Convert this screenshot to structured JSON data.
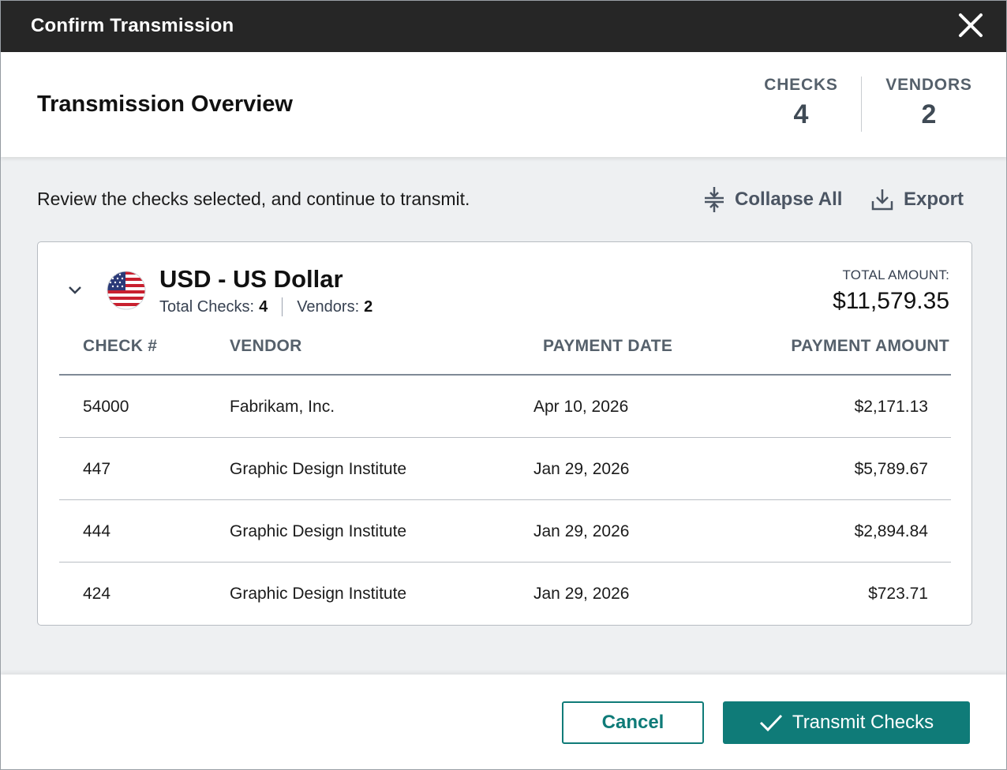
{
  "dialog": {
    "title": "Confirm Transmission"
  },
  "overview": {
    "title": "Transmission Overview",
    "checks_label": "CHECKS",
    "checks_value": "4",
    "vendors_label": "VENDORS",
    "vendors_value": "2"
  },
  "toolbar": {
    "review_text": "Review the checks selected, and continue to transmit.",
    "collapse_label": "Collapse All",
    "export_label": "Export"
  },
  "currency_group": {
    "name": "USD - US Dollar",
    "total_checks_label": "Total Checks:",
    "total_checks_value": "4",
    "vendors_label": "Vendors:",
    "vendors_value": "2",
    "total_amount_label": "TOTAL AMOUNT:",
    "total_amount_value": "$11,579.35",
    "flag_icon": "us-flag-icon"
  },
  "table": {
    "columns": [
      "CHECK #",
      "VENDOR",
      "PAYMENT DATE",
      "PAYMENT AMOUNT"
    ],
    "rows": [
      {
        "check": "54000",
        "vendor": "Fabrikam, Inc.",
        "date": "Apr 10, 2026",
        "amount": "$2,171.13"
      },
      {
        "check": "447",
        "vendor": "Graphic Design Institute",
        "date": "Jan 29, 2026",
        "amount": "$5,789.67"
      },
      {
        "check": "444",
        "vendor": "Graphic Design Institute",
        "date": "Jan 29, 2026",
        "amount": "$2,894.84"
      },
      {
        "check": "424",
        "vendor": "Graphic Design Institute",
        "date": "Jan 29, 2026",
        "amount": "$723.71"
      }
    ]
  },
  "footer": {
    "cancel_label": "Cancel",
    "transmit_label": "Transmit Checks"
  },
  "colors": {
    "accent": "#0f7b78",
    "titlebar": "#262626",
    "body_bg": "#eef0f2"
  }
}
